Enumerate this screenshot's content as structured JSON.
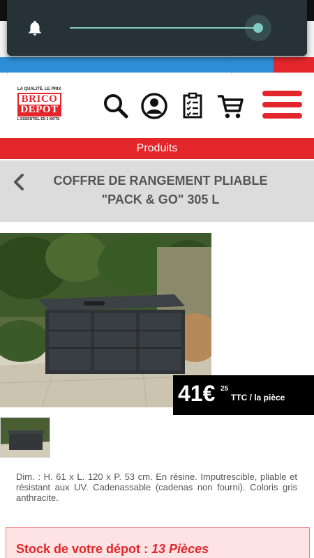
{
  "notification": {
    "icon": "bell-icon",
    "brightness_level": 0.93,
    "accent_color": "#80cbc4"
  },
  "header": {
    "logo": {
      "tagline_top": "LA QUALITÉ, LE PRIX",
      "brand_line1": "BRICO",
      "brand_line2": "DEPOT",
      "tagline_bottom": "L'ESSENTIEL EN 2 MOTS"
    },
    "icons": [
      "search-icon",
      "account-icon",
      "list-icon",
      "cart-icon",
      "menu-icon"
    ],
    "brand_color": "#e3262b"
  },
  "nav": {
    "products_label": "Produits"
  },
  "product": {
    "title": "COFFRE DE RANGEMENT PLIABLE \"PACK & GO\" 305 L",
    "price_main": "41€",
    "price_cents": "25",
    "price_unit": "TTC / la pièce",
    "description": "Dim. : H. 61 x L. 120 x P. 53 cm. En résine. Imputrescible, pliable et résistant aux UV. Cadenassable (cadenas non fourni). Coloris gris anthracite."
  },
  "stock": {
    "label": "Stock de votre dépot : ",
    "value": "13 Pièces"
  }
}
